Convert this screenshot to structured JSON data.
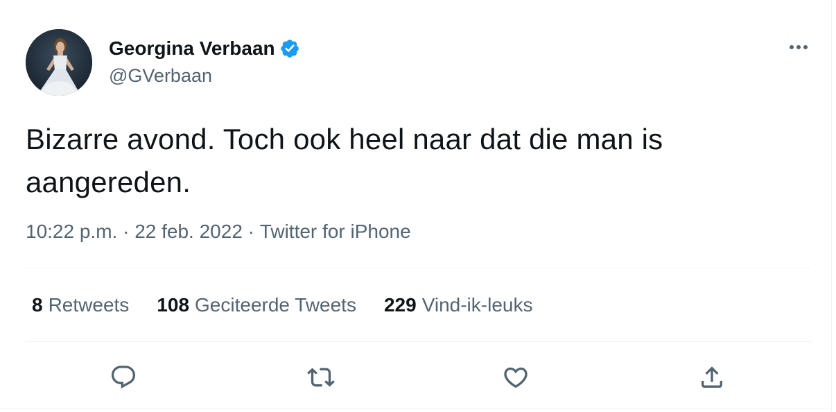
{
  "user": {
    "display_name": "Georgina Verbaan",
    "handle": "@GVerbaan",
    "verified": true
  },
  "tweet": {
    "text": "Bizarre avond. Toch ook heel naar dat die man is aangereden.",
    "time": "10:22 p.m.",
    "date": "22 feb. 2022",
    "source": "Twitter for iPhone",
    "separator": " · "
  },
  "stats": {
    "retweets": {
      "count": "8",
      "label": "Retweets"
    },
    "quotes": {
      "count": "108",
      "label": "Geciteerde Tweets"
    },
    "likes": {
      "count": "229",
      "label": "Vind-ik-leuks"
    }
  },
  "icons": {
    "more": "more-horizontal-icon",
    "reply": "reply-icon",
    "retweet": "retweet-icon",
    "like": "heart-icon",
    "share": "share-icon",
    "verified": "verified-badge-icon"
  },
  "colors": {
    "text_primary": "#0f1419",
    "text_secondary": "#536471",
    "verified_blue": "#1d9bf0",
    "divider": "#eff3f4"
  }
}
